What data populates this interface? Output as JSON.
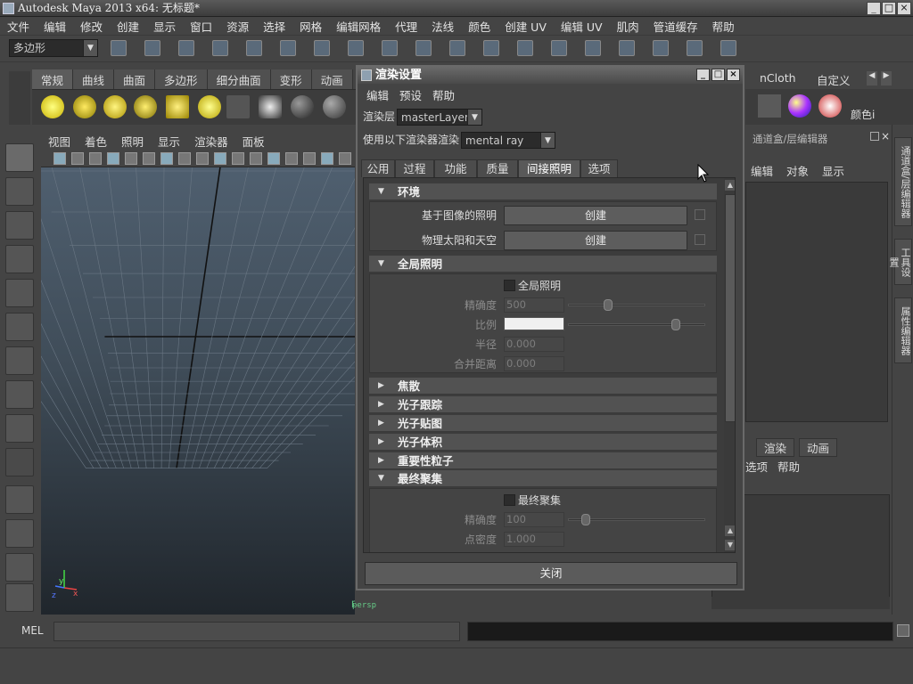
{
  "window": {
    "title": "Autodesk Maya 2013 x64: 无标题*"
  },
  "main_menu": [
    "文件",
    "编辑",
    "修改",
    "创建",
    "显示",
    "窗口",
    "资源",
    "选择",
    "网格",
    "编辑网格",
    "代理",
    "法线",
    "颜色",
    "创建 UV",
    "编辑 UV",
    "肌肉",
    "管道缓存",
    "帮助"
  ],
  "menu_set": {
    "value": "多边形"
  },
  "shelf_tabs": [
    "常规",
    "曲线",
    "曲面",
    "多边形",
    "细分曲面",
    "变形",
    "动画"
  ],
  "shelf_right": {
    "ncloth": "nCloth",
    "custom": "自定义",
    "color_tool": "颜色i"
  },
  "viewport": {
    "menus": [
      "视图",
      "着色",
      "照明",
      "显示",
      "渲染器",
      "面板"
    ],
    "camera_label": "persp",
    "axis_labels": {
      "x": "x",
      "y": "y",
      "z": "z"
    }
  },
  "right_panel": {
    "title": "通道盒/层编辑器",
    "menus": [
      "编辑",
      "对象",
      "显示"
    ],
    "layer_tabs": [
      "渲染",
      "动画"
    ],
    "layer_menus": [
      "选项",
      "帮助"
    ],
    "side_tabs": [
      "通道盒/层编辑器",
      "工具设置",
      "属性编辑器"
    ]
  },
  "command_line": {
    "label": "MEL"
  },
  "dialog": {
    "title": "渲染设置",
    "menus": [
      "编辑",
      "预设",
      "帮助"
    ],
    "render_layer_label": "渲染层",
    "render_layer_value": "masterLayer",
    "renderer_label": "使用以下渲染器渲染",
    "renderer_value": "mental ray",
    "tabs": [
      "公用",
      "过程",
      "功能",
      "质量",
      "间接照明",
      "选项"
    ],
    "active_tab": "间接照明",
    "sections": {
      "environment": {
        "title": "环境",
        "rows": [
          {
            "label": "基于图像的照明",
            "button": "创建"
          },
          {
            "label": "物理太阳和天空",
            "button": "创建"
          }
        ]
      },
      "gi": {
        "title": "全局照明",
        "checkbox": "全局照明",
        "checked": false,
        "fields": {
          "accuracy": {
            "label": "精确度",
            "value": "500"
          },
          "scale": {
            "label": "比例"
          },
          "radius": {
            "label": "半径",
            "value": "0.000"
          },
          "merge_distance": {
            "label": "合并距离",
            "value": "0.000"
          }
        },
        "accuracy_slider": 0.26,
        "scale_color": "#f0f0f0"
      },
      "collapsed": [
        "焦散",
        "光子跟踪",
        "光子贴图",
        "光子体积",
        "重要性粒子"
      ],
      "final_gather": {
        "title": "最终聚集",
        "checkbox": "最终聚集",
        "checked": false,
        "fields": {
          "accuracy": {
            "label": "精确度",
            "value": "100"
          },
          "point_density": {
            "label": "点密度",
            "value": "1.000"
          }
        },
        "accuracy_slider": 0.1
      }
    },
    "close_button": "关闭"
  },
  "colors": {
    "background": "#444444",
    "viewport_top": "#4f5f6f",
    "viewport_bottom": "#20262c"
  }
}
